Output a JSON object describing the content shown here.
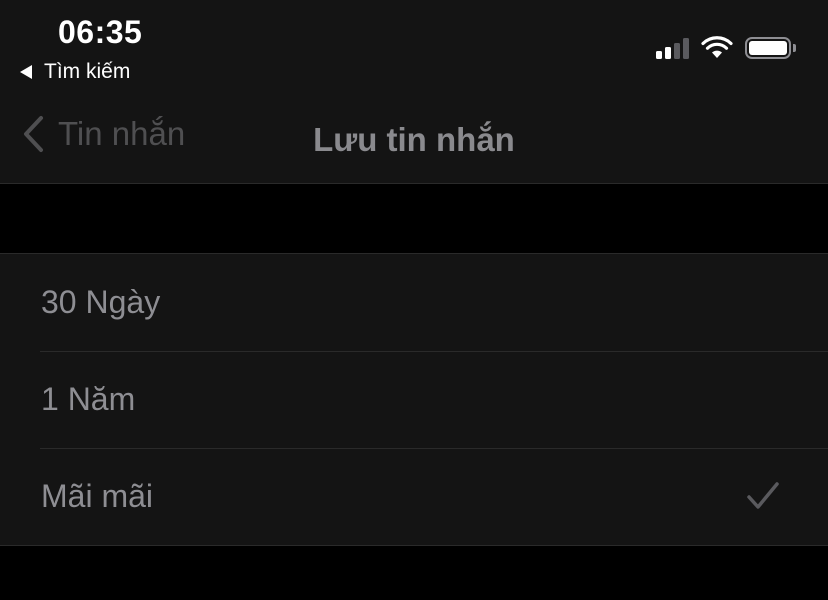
{
  "status_bar": {
    "time": "06:35",
    "back_app_label": "Tìm kiếm",
    "signal_icon": "cellular-signal-icon",
    "wifi_icon": "wifi-icon",
    "battery_icon": "battery-icon",
    "battery_level": 1.0,
    "signal_bars_active": 2,
    "signal_bars_total": 4
  },
  "nav": {
    "back_label": "Tin nhắn",
    "back_icon": "chevron-left-icon",
    "title": "Lưu tin nhắn"
  },
  "options": [
    {
      "label": "30 Ngày",
      "selected": false
    },
    {
      "label": "1 Năm",
      "selected": false
    },
    {
      "label": "Mãi mãi",
      "selected": true
    }
  ],
  "colors": {
    "background": "#000000",
    "surface": "#141414",
    "separator": "#2a2a2a",
    "text_dim": "#8e8e93",
    "nav_back": "#4f4f51",
    "check": "#5a5a5e",
    "status_text": "#ffffff"
  }
}
